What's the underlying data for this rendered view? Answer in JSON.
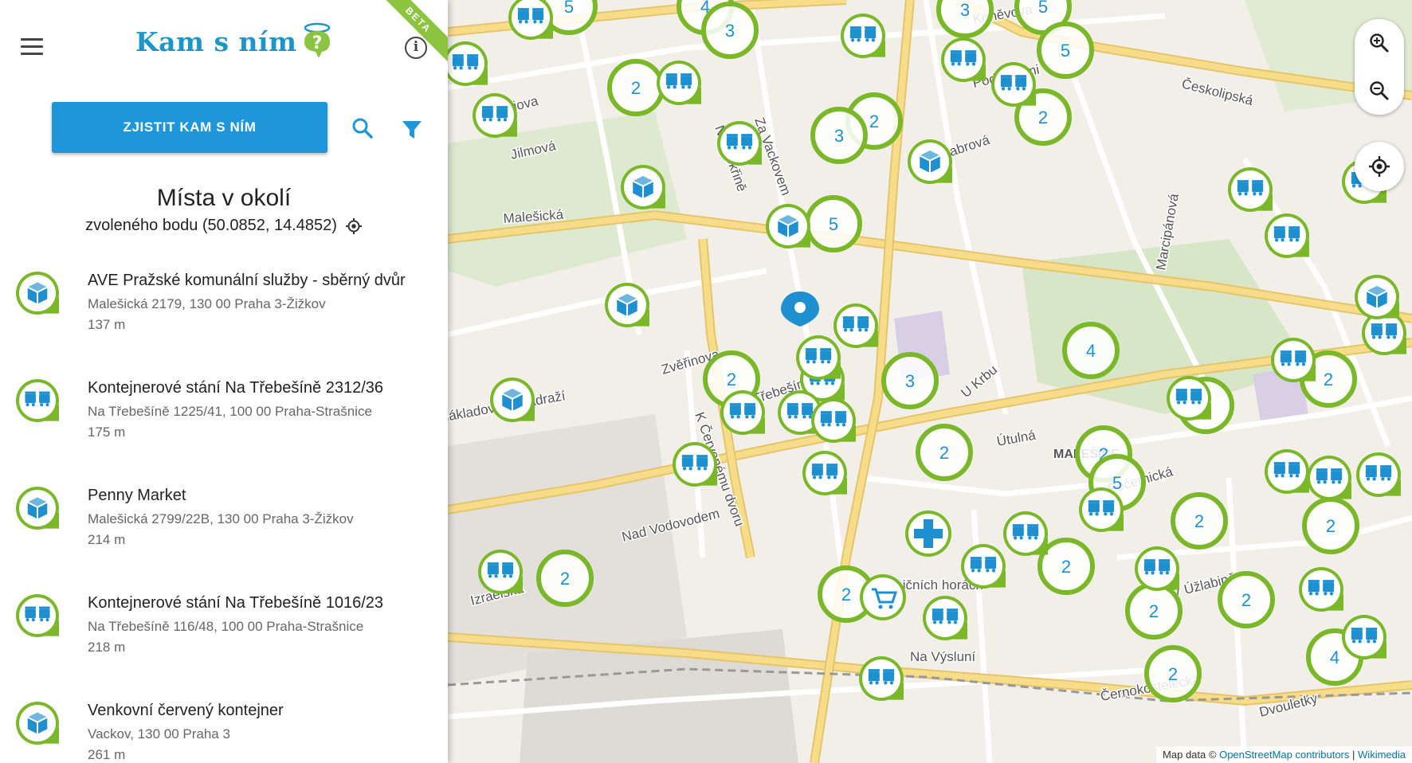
{
  "app": {
    "logo_main": "Kam s ním",
    "beta_label": "BETA"
  },
  "actions": {
    "primary_button": "ZJISTIT KAM S NÍM"
  },
  "nearby": {
    "title": "Místa v okolí",
    "subtitle": "zvoleného bodu (50.0852, 14.4852)"
  },
  "places": [
    {
      "icon": "box-pin-icon",
      "name": "AVE Pražské komunální služby - sběrný dvůr",
      "address": "Malešická 2179, 130 00 Praha 3-Žižkov",
      "distance": "137 m"
    },
    {
      "icon": "bins-pin-icon",
      "name": "Kontejnerové stání Na Třebešíně 2312/36",
      "address": "Na Třebešíně 1225/41, 100 00 Praha-Strašnice",
      "distance": "175 m"
    },
    {
      "icon": "box-pin-icon",
      "name": "Penny Market",
      "address": "Malešická 2799/22B, 130 00 Praha 3-Žižkov",
      "distance": "214 m"
    },
    {
      "icon": "bins-pin-icon",
      "name": "Kontejnerové stání Na Třebešíně 1016/23",
      "address": "Na Třebešíně 116/48, 100 00 Praha-Strašnice",
      "distance": "218 m"
    },
    {
      "icon": "box-pin-icon",
      "name": "Venkovní červený kontejner",
      "address": "Vackov, 130 00 Praha 3",
      "distance": "261 m"
    }
  ],
  "map": {
    "street_labels": [
      "Jeseniova",
      "Jilmová",
      "Malešická",
      "Habrová",
      "Pod Lipami",
      "Českolipská",
      "Na Mokřině",
      "Za Vackovem",
      "Nákladového nádraží",
      "Zvěřinova",
      "Na Třebešíně",
      "K Červenému dvoru",
      "Nad Vodovodem",
      "Izraelská",
      "U Krbu",
      "Útulná",
      "Počernická",
      "Na Viničních horách",
      "V Úžlabině",
      "Na Výsluní",
      "Černokostelecká",
      "Marcipánová",
      "Dvouletky",
      "Koněvova",
      "MALEŠICE"
    ],
    "cluster_counts": [
      5,
      4,
      5,
      3,
      3,
      2,
      5,
      2,
      3,
      2,
      5,
      2,
      2,
      3,
      2,
      4,
      2,
      2,
      2,
      2,
      5,
      2,
      2,
      2,
      4,
      2,
      2,
      2
    ],
    "attribution_prefix": "Map data ©",
    "attribution_osm": "OpenStreetMap contributors",
    "attribution_sep": "|",
    "attribution_wiki": "Wikimedia"
  },
  "colors": {
    "primary_blue": "#1e96d9",
    "marker_green": "#7ab829",
    "marker_blue": "#1e90d0",
    "beta_green": "#8bc53f"
  }
}
